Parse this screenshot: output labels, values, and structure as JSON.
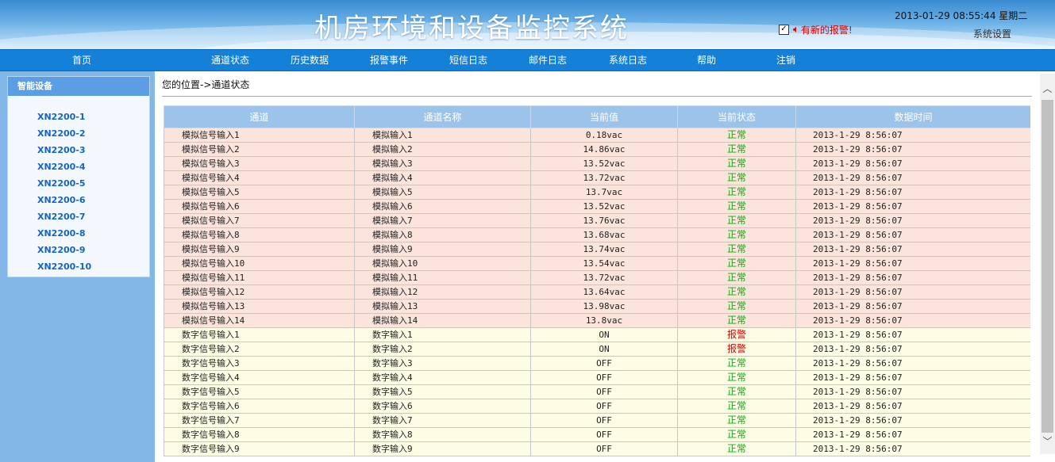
{
  "header": {
    "title": "机房环境和设备监控系统",
    "alert_checked": true,
    "alert_text": "有新的报警!",
    "datetime": "2013-01-29 08:55:44 星期二",
    "settings": "系统设置"
  },
  "nav": [
    "首页",
    "通道状态",
    "历史数据",
    "报警事件",
    "短信日志",
    "邮件日志",
    "系统日志",
    "帮助",
    "注销"
  ],
  "sidebar": {
    "title": "智能设备",
    "items": [
      "XN2200-1",
      "XN2200-2",
      "XN2200-3",
      "XN2200-4",
      "XN2200-5",
      "XN2200-6",
      "XN2200-7",
      "XN2200-8",
      "XN2200-9",
      "XN2200-10"
    ]
  },
  "breadcrumb": "您的位置->通道状态",
  "table": {
    "columns": [
      "通道",
      "通道名称",
      "当前值",
      "当前状态",
      "数据时间"
    ],
    "rows": [
      {
        "type": "analog",
        "ch": "模拟信号输入1",
        "name": "模拟输入1",
        "value": "0.18vac",
        "status": "正常",
        "time": "2013-1-29 8:56:07"
      },
      {
        "type": "analog",
        "ch": "模拟信号输入2",
        "name": "模拟输入2",
        "value": "14.86vac",
        "status": "正常",
        "time": "2013-1-29 8:56:07"
      },
      {
        "type": "analog",
        "ch": "模拟信号输入3",
        "name": "模拟输入3",
        "value": "13.52vac",
        "status": "正常",
        "time": "2013-1-29 8:56:07"
      },
      {
        "type": "analog",
        "ch": "模拟信号输入4",
        "name": "模拟输入4",
        "value": "13.72vac",
        "status": "正常",
        "time": "2013-1-29 8:56:07"
      },
      {
        "type": "analog",
        "ch": "模拟信号输入5",
        "name": "模拟输入5",
        "value": "13.7vac",
        "status": "正常",
        "time": "2013-1-29 8:56:07"
      },
      {
        "type": "analog",
        "ch": "模拟信号输入6",
        "name": "模拟输入6",
        "value": "13.52vac",
        "status": "正常",
        "time": "2013-1-29 8:56:07"
      },
      {
        "type": "analog",
        "ch": "模拟信号输入7",
        "name": "模拟输入7",
        "value": "13.76vac",
        "status": "正常",
        "time": "2013-1-29 8:56:07"
      },
      {
        "type": "analog",
        "ch": "模拟信号输入8",
        "name": "模拟输入8",
        "value": "13.68vac",
        "status": "正常",
        "time": "2013-1-29 8:56:07"
      },
      {
        "type": "analog",
        "ch": "模拟信号输入9",
        "name": "模拟输入9",
        "value": "13.74vac",
        "status": "正常",
        "time": "2013-1-29 8:56:07"
      },
      {
        "type": "analog",
        "ch": "模拟信号输入10",
        "name": "模拟输入10",
        "value": "13.54vac",
        "status": "正常",
        "time": "2013-1-29 8:56:07"
      },
      {
        "type": "analog",
        "ch": "模拟信号输入11",
        "name": "模拟输入11",
        "value": "13.72vac",
        "status": "正常",
        "time": "2013-1-29 8:56:07"
      },
      {
        "type": "analog",
        "ch": "模拟信号输入12",
        "name": "模拟输入12",
        "value": "13.64vac",
        "status": "正常",
        "time": "2013-1-29 8:56:07"
      },
      {
        "type": "analog",
        "ch": "模拟信号输入13",
        "name": "模拟输入13",
        "value": "13.98vac",
        "status": "正常",
        "time": "2013-1-29 8:56:07"
      },
      {
        "type": "analog",
        "ch": "模拟信号输入14",
        "name": "模拟输入14",
        "value": "13.8vac",
        "status": "正常",
        "time": "2013-1-29 8:56:07"
      },
      {
        "type": "digital",
        "ch": "数字信号输入1",
        "name": "数字输入1",
        "value": "ON",
        "status": "报警",
        "time": "2013-1-29 8:56:07"
      },
      {
        "type": "digital",
        "ch": "数字信号输入2",
        "name": "数字输入2",
        "value": "ON",
        "status": "报警",
        "time": "2013-1-29 8:56:07"
      },
      {
        "type": "digital",
        "ch": "数字信号输入3",
        "name": "数字输入3",
        "value": "OFF",
        "status": "正常",
        "time": "2013-1-29 8:56:07"
      },
      {
        "type": "digital",
        "ch": "数字信号输入4",
        "name": "数字输入4",
        "value": "OFF",
        "status": "正常",
        "time": "2013-1-29 8:56:07"
      },
      {
        "type": "digital",
        "ch": "数字信号输入5",
        "name": "数字输入5",
        "value": "OFF",
        "status": "正常",
        "time": "2013-1-29 8:56:07"
      },
      {
        "type": "digital",
        "ch": "数字信号输入6",
        "name": "数字输入6",
        "value": "OFF",
        "status": "正常",
        "time": "2013-1-29 8:56:07"
      },
      {
        "type": "digital",
        "ch": "数字信号输入7",
        "name": "数字输入7",
        "value": "OFF",
        "status": "正常",
        "time": "2013-1-29 8:56:07"
      },
      {
        "type": "digital",
        "ch": "数字信号输入8",
        "name": "数字输入8",
        "value": "OFF",
        "status": "正常",
        "time": "2013-1-29 8:56:07"
      },
      {
        "type": "digital",
        "ch": "数字信号输入9",
        "name": "数字输入9",
        "value": "OFF",
        "status": "正常",
        "time": "2013-1-29 8:56:07"
      }
    ]
  },
  "icons": {
    "speaker": "speaker-icon",
    "check": "checkbox-check-icon",
    "scroll_up": "chevron-up-icon",
    "scroll_down": "chevron-down-icon"
  },
  "colors": {
    "nav_bg": "#1580d8",
    "status_ok": "#11a611",
    "status_alarm": "#e00000",
    "alert_text": "#e00000",
    "analog_row": "#fbe4dc",
    "digital_row": "#fdfde6",
    "header_row": "#9cc4ea"
  }
}
